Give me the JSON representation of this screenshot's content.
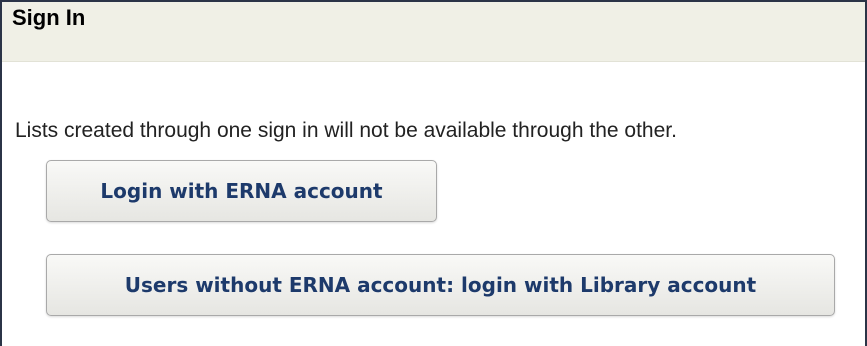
{
  "header": {
    "title": "Sign In"
  },
  "notice": {
    "text": "Lists created through one sign in will not be available through the other."
  },
  "buttons": {
    "erna_login_label": "Login with ERNA account",
    "library_login_label": "Users without ERNA account: login with Library account"
  },
  "colors": {
    "header_background": "#f0f0e6",
    "button_text": "#1d3a6b",
    "panel_border": "#2b3447"
  }
}
